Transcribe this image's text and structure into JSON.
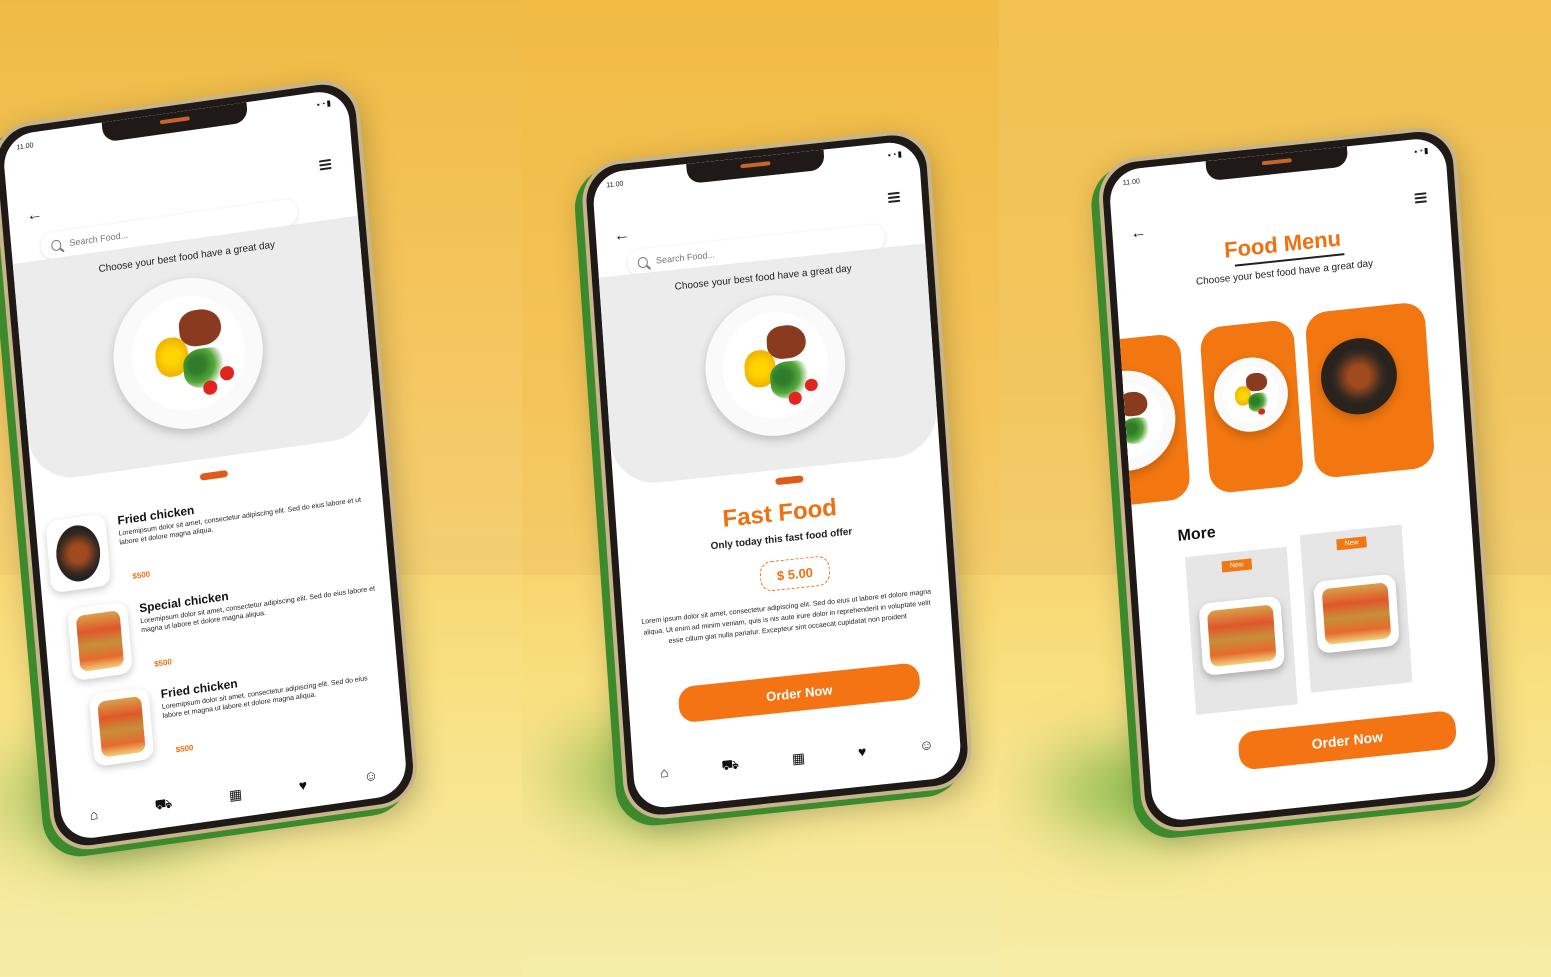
{
  "colors": {
    "accent": "#f47312",
    "background": "#f3c25a"
  },
  "status": {
    "time": "11.00"
  },
  "search": {
    "placeholder": "Search Food..."
  },
  "tagline": "Choose your best food  have a great day",
  "icons": {
    "back": "arrow-left-icon",
    "menu": "hamburger-icon",
    "search": "search-icon",
    "home": "home-icon",
    "cart": "cart-icon",
    "grid": "grid-icon",
    "favorite": "heart-icon",
    "profile": "user-icon"
  },
  "list_screen": {
    "items": [
      {
        "name": "Fried chicken",
        "desc": "Loremipsum dolor sit amet, consectetur adipiscing elit. Sed do eius labore et ut labore et dolore magna aliqua.",
        "price": "$500"
      },
      {
        "name": "Special chicken",
        "desc": "Loremipsum dolor sit amet, consectetur adipiscing elit. Sed do eius labore et magna ut labore et dolore magna aliqua.",
        "price": "$500"
      },
      {
        "name": "Fried chicken",
        "desc": "Loremipsum dolor sit amet, consectetur adipiscing elit. Sed do eius labore et magna ut labore et dolore magna aliqua.",
        "price": "$500"
      }
    ]
  },
  "detail_screen": {
    "title": "Fast Food",
    "subtitle": "Only today this fast food offer",
    "price": "$ 5.00",
    "description": "Lorem ipsum dolor sit amet, consectetur adipiscing elit. Sed do eius ut labore et dolore magna aliqua. Ut enim ad minim veniam, quis is nis aute irure dolor in reprehenderit in voluptate velit esse cillum giat nulla pariatur. Excepteur sint occaecat cupidatat non proident",
    "order_button": "Order Now"
  },
  "menu_screen": {
    "title": "Food Menu",
    "subtitle": "Choose your best food  have a great day",
    "more_label": "More",
    "badge": "New",
    "order_button": "Order Now"
  }
}
